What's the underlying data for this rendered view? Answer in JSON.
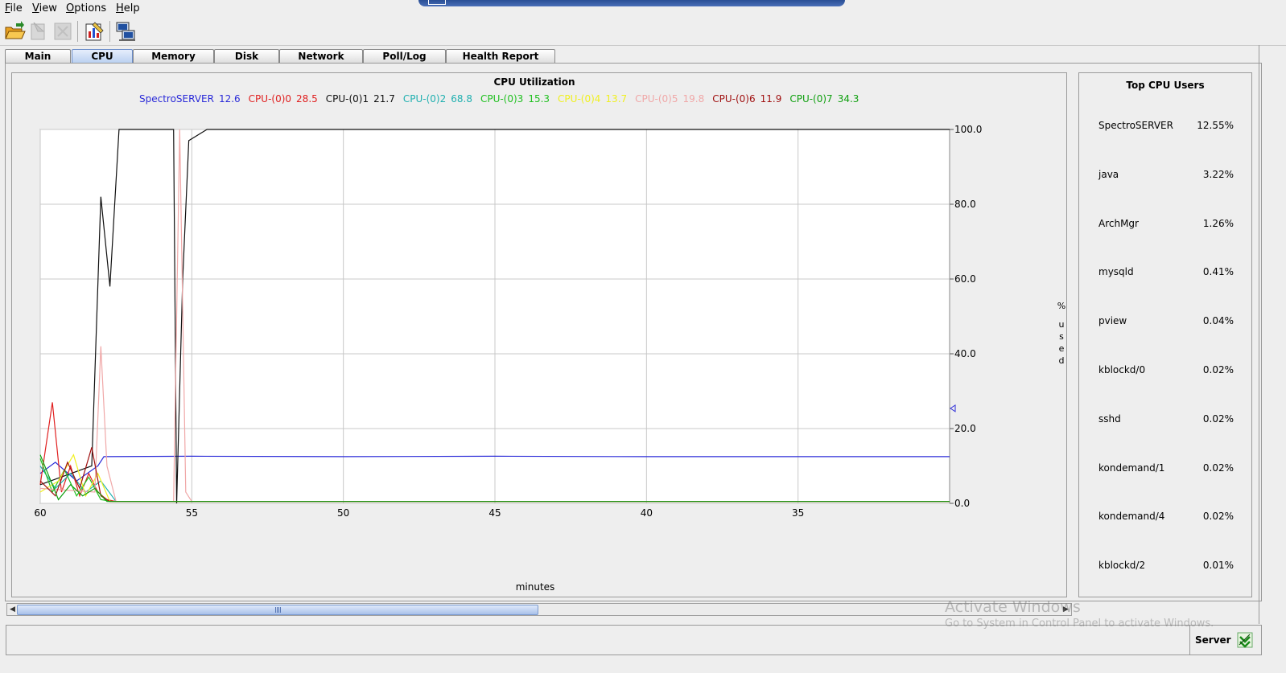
{
  "menu": {
    "items": [
      {
        "key": "F",
        "rest": "ile"
      },
      {
        "key": "V",
        "rest": "iew"
      },
      {
        "key": "O",
        "rest": "ptions"
      },
      {
        "key": "H",
        "rest": "elp"
      }
    ]
  },
  "toolbar": {
    "buttons": [
      "open-folder-icon",
      "disabled-icon",
      "disabled-icon",
      "edit-chart-icon",
      "network-computer-icon"
    ]
  },
  "tabs": [
    "Main",
    "CPU",
    "Memory",
    "Disk",
    "Network",
    "Poll/Log",
    "Health Report"
  ],
  "active_tab": "CPU",
  "top_users": {
    "title": "Top CPU Users",
    "rows": [
      {
        "name": "SpectroSERVER",
        "pct": "12.55%"
      },
      {
        "name": "java",
        "pct": "3.22%"
      },
      {
        "name": "ArchMgr",
        "pct": "1.26%"
      },
      {
        "name": "mysqld",
        "pct": "0.41%"
      },
      {
        "name": "pview",
        "pct": "0.04%"
      },
      {
        "name": "kblockd/0",
        "pct": "0.02%"
      },
      {
        "name": "sshd",
        "pct": "0.02%"
      },
      {
        "name": "kondemand/1",
        "pct": "0.02%"
      },
      {
        "name": "kondemand/4",
        "pct": "0.02%"
      },
      {
        "name": "kblockd/2",
        "pct": "0.01%"
      }
    ]
  },
  "status": {
    "server_label": "Server"
  },
  "watermark": {
    "line1": "Activate Windows",
    "line2": "Go to System in Control Panel to activate Windows."
  },
  "chart_data": {
    "type": "line",
    "title": "CPU Utilization",
    "xlabel": "minutes",
    "ylabel_chars": [
      "%",
      "u",
      "s",
      "e",
      "d"
    ],
    "xlim": [
      60,
      30
    ],
    "ylim": [
      0,
      100
    ],
    "x_ticks": [
      60,
      55,
      50,
      45,
      40,
      35
    ],
    "x_tick_labels": [
      "60",
      "55",
      "50",
      "45",
      "40",
      "35"
    ],
    "y_ticks": [
      0,
      20,
      40,
      60,
      80,
      100
    ],
    "y_tick_labels": [
      "0.0",
      "20.0",
      "40.0",
      "60.0",
      "80.0",
      "100.0"
    ],
    "grid": true,
    "series": [
      {
        "name": "SpectroSERVER",
        "value_label": "12.6",
        "color": "#2a2ad8",
        "x": [
          60,
          59.5,
          58.8,
          58.1,
          57.9,
          55,
          50,
          45,
          40,
          35,
          30
        ],
        "y": [
          8,
          11,
          6,
          10,
          12.5,
          12.6,
          12.5,
          12.6,
          12.5,
          12.5,
          12.5
        ]
      },
      {
        "name": "CPU-(0)0",
        "value_label": "28.5",
        "color": "#e02020",
        "x": [
          60,
          59.6,
          59.3,
          59,
          58.7,
          58.4,
          58.1,
          57.8,
          57.5,
          55,
          50,
          45,
          40,
          35,
          30
        ],
        "y": [
          5,
          27,
          3,
          10,
          2,
          8,
          3,
          1,
          0.5,
          0.5,
          0.5,
          0.5,
          0.5,
          0.5,
          0.5
        ]
      },
      {
        "name": "CPU-(0)1",
        "value_label": "21.7",
        "color": "#101010",
        "x": [
          60,
          58.3,
          58,
          57.7,
          57.4,
          57.1,
          55.9,
          55.6,
          55.5,
          55.3,
          55.1,
          54.5,
          50,
          45,
          40,
          35,
          30
        ],
        "y": [
          5,
          10,
          82,
          58,
          100,
          100,
          100,
          100,
          0,
          60,
          97,
          100,
          100,
          100,
          100,
          100,
          100
        ]
      },
      {
        "name": "CPU-(0)2",
        "value_label": "68.8",
        "color": "#20b0b0",
        "x": [
          60,
          59.5,
          59,
          58.5,
          58,
          57.5,
          50,
          40,
          30
        ],
        "y": [
          10,
          4,
          8,
          3,
          6,
          0.5,
          0.5,
          0.5,
          0.5
        ]
      },
      {
        "name": "CPU-(0)3",
        "value_label": "15.3",
        "color": "#20c020",
        "x": [
          60,
          59.6,
          59.2,
          58.8,
          58.4,
          58,
          57.6,
          50,
          40,
          30
        ],
        "y": [
          12,
          3,
          9,
          2,
          7,
          1,
          0.5,
          0.5,
          0.5,
          0.5
        ]
      },
      {
        "name": "CPU-(0)4",
        "value_label": "13.7",
        "color": "#f0f020",
        "x": [
          60,
          59.4,
          58.9,
          58.5,
          58.1,
          57.7,
          50,
          40,
          30
        ],
        "y": [
          3,
          6,
          13,
          2,
          8,
          0.5,
          0.5,
          0.5,
          0.5
        ]
      },
      {
        "name": "CPU-(0)5",
        "value_label": "19.8",
        "color": "#f0a8a8",
        "x": [
          60,
          58.2,
          58,
          57.8,
          57.5,
          55.6,
          55.4,
          55.2,
          55,
          50,
          40,
          30
        ],
        "y": [
          4,
          3,
          42,
          10,
          0.5,
          0.5,
          100,
          3,
          0.5,
          0.5,
          0.5,
          0.5
        ]
      },
      {
        "name": "CPU-(0)6",
        "value_label": "11.9",
        "color": "#a01010",
        "x": [
          60,
          59.5,
          59.1,
          58.7,
          58.3,
          58,
          57.7,
          50,
          40,
          30
        ],
        "y": [
          6,
          2,
          11,
          4,
          15,
          2,
          0.5,
          0.5,
          0.5,
          0.5
        ]
      },
      {
        "name": "CPU-(0)7",
        "value_label": "34.3",
        "color": "#10a010",
        "x": [
          60,
          59.4,
          59,
          58.6,
          58.2,
          57.8,
          50,
          40,
          30
        ],
        "y": [
          13,
          1,
          5,
          2,
          4,
          0.5,
          0.5,
          0.5,
          0.5
        ]
      }
    ]
  }
}
